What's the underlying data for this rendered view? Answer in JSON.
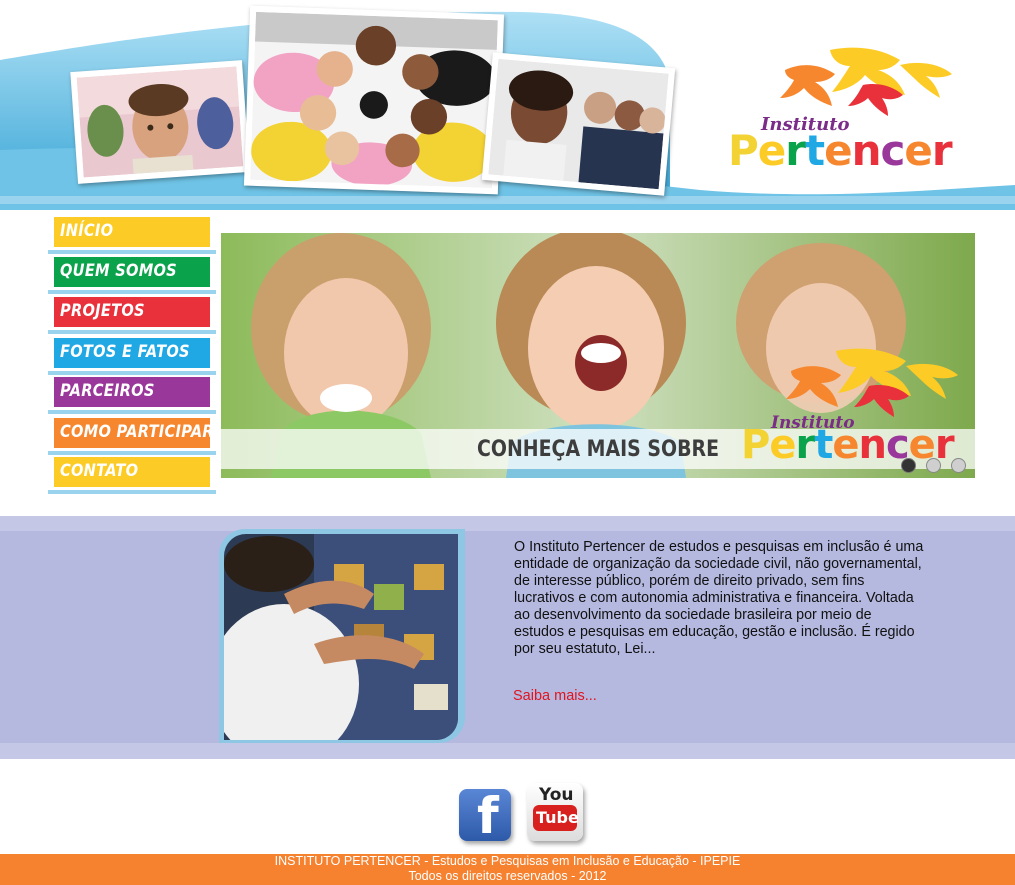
{
  "header": {
    "logo": {
      "line1": "Instituto",
      "line2": "Pertencer"
    }
  },
  "nav": {
    "items": [
      {
        "label": "INÍCIO",
        "color": "#fdcb25"
      },
      {
        "label": "QUEM SOMOS",
        "color": "#0aa24b"
      },
      {
        "label": "PROJETOS",
        "color": "#e8313a"
      },
      {
        "label": "FOTOS E FATOS",
        "color": "#20a8e4"
      },
      {
        "label": "PARCEIROS",
        "color": "#99379a"
      },
      {
        "label": "COMO PARTICIPAR",
        "color": "#f6872e"
      },
      {
        "label": "CONTATO",
        "color": "#fdcb25"
      }
    ]
  },
  "banner": {
    "caption": "CONHEÇA MAIS SOBRE",
    "logo_line1": "Instituto",
    "logo_line2": "Pertencer",
    "slides": 3,
    "active_slide": 1
  },
  "about": {
    "text": "O Instituto Pertencer de estudos e pesquisas em inclusão é uma entidade de organização da sociedade civil, não governamental, de interesse público, porém de direito privado, sem fins lucrativos e com autonomia administrativa e financeira. Voltada ao desenvolvimento da sociedade brasileira por meio de estudos e pesquisas em educação, gestão e inclusão. É regido por seu estatuto, Lei...",
    "read_more": "Saiba mais..."
  },
  "social": {
    "facebook_letter": "f",
    "youtube_you": "You",
    "youtube_tube": "Tube"
  },
  "footer": {
    "line1": "INSTITUTO PERTENCER - Estudos e Pesquisas em Inclusão e Educação - IPEPIE",
    "line2": "Todos os direitos reservados - 2012"
  },
  "colors": {
    "band": "#b5b9e0",
    "footer": "#f6812f",
    "link": "#e0141e"
  }
}
